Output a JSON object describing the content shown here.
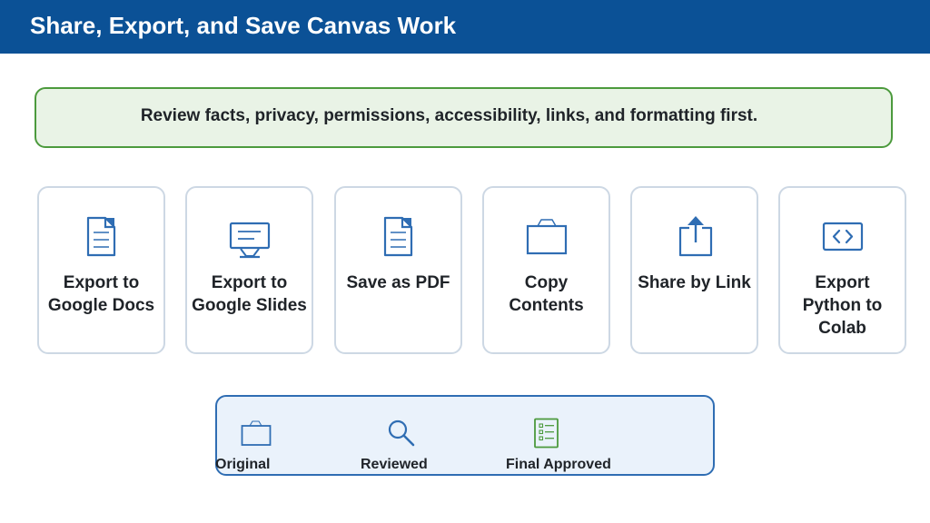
{
  "header": {
    "title": "Share, Export, and Save Canvas Work"
  },
  "note": {
    "text": "Review facts, privacy, permissions, accessibility, links, and formatting first."
  },
  "cards": [
    {
      "label": "Export to Google Docs",
      "icon": "document-icon"
    },
    {
      "label": "Export to Google Slides",
      "icon": "presentation-icon"
    },
    {
      "label": "Save as PDF",
      "icon": "pdf-document-icon"
    },
    {
      "label": "Copy Contents",
      "icon": "clipboard-icon"
    },
    {
      "label": "Share by Link",
      "icon": "share-icon"
    },
    {
      "label": "Export Python to Colab",
      "icon": "code-icon"
    }
  ],
  "legend": {
    "items": [
      {
        "label": "Original",
        "icon": "folder-icon"
      },
      {
        "label": "Reviewed",
        "icon": "magnifier-icon"
      },
      {
        "label": "Final Approved",
        "icon": "checklist-icon"
      }
    ]
  },
  "colors": {
    "header": "#0b5196",
    "icon_blue": "#2f6db3",
    "note_border": "#4c9a3d",
    "note_fill": "#e9f3e6",
    "legend_fill": "#eaf2fb",
    "checklist_green": "#4c9a3d"
  }
}
